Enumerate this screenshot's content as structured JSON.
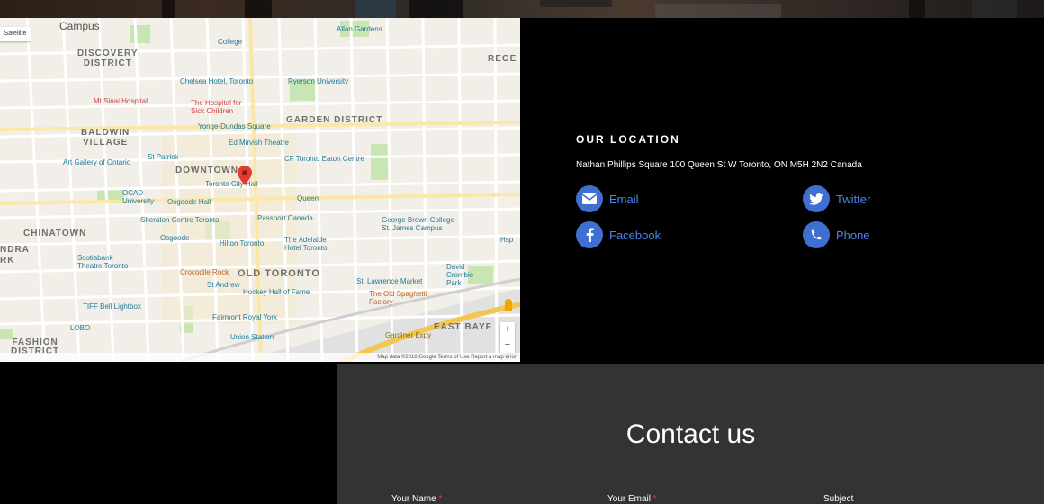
{
  "map": {
    "satellite_label": "Satellite",
    "zoom_in": "+",
    "zoom_out": "−",
    "footer": "Map data ©2018 Google   Terms of Use   Report a map error",
    "labels": {
      "campus": "Campus",
      "discovery_district": "DISCOVERY\nDISTRICT",
      "garden_district": "GARDEN DISTRICT",
      "baldwin_village": "BALDWIN\nVILLAGE",
      "downtown": "DOWNTOWN",
      "chinatown": "CHINATOWN",
      "old_toronto": "OLD TORONTO",
      "fashion_district": "FASHION\nDISTRICT",
      "east_bayfront": "EAST BAYF",
      "regent": "REGE",
      "ndra": "NDRA",
      "rk": "RK"
    },
    "pois": {
      "college": "College",
      "allan_gardens": "Allan Gardens",
      "chelsea_hotel": "Chelsea Hotel, Toronto",
      "ryerson": "Ryerson University",
      "mt_sinai": "Mt Sinai Hospital",
      "sick_children": "The Hospital for Sick Children",
      "yonge_dundas": "Yonge-Dundas Square",
      "ed_mirvish": "Ed Mirvish Theatre",
      "cf_eaton": "CF Toronto Eaton Centre",
      "art_gallery": "Art Gallery of Ontario",
      "st_patrick": "St Patrick",
      "toronto_city_hall": "Toronto City Hall",
      "ocad": "OCAD University",
      "osgoode_hall": "Osgoode Hall",
      "queen": "Queen",
      "sheraton": "Sheraton Centre Toronto",
      "passport_canada": "Passport Canada",
      "george_brown": "George Brown College St. James Campus",
      "osgoode": "Osgoode",
      "hilton": "Hilton Toronto",
      "adelaide": "The Adelaide Hotel Toronto",
      "scotiabank": "Scotiabank Theatre Toronto",
      "crocodile": "Crocodile Rock",
      "st_andrew": "St Andrew",
      "hockey_hall": "Hockey Hall of Fame",
      "st_lawrence": "St. Lawrence Market",
      "david_crombie": "David Crombie Park",
      "tiff": "TIFF Bell Lightbox",
      "fairmont": "Fairmont Royal York",
      "old_spaghetti": "The Old Spaghetti Factory",
      "union": "Union Station",
      "lobo": "LOBO",
      "gardiner": "Gardiner Expy",
      "hsp": "Hsp"
    }
  },
  "location": {
    "title": "OUR LOCATION",
    "address": "Nathan Phillips Square 100 Queen St W Toronto, ON M5H 2N2 Canada",
    "links": [
      {
        "label": "Email",
        "icon": "envelope-icon"
      },
      {
        "label": "Twitter",
        "icon": "twitter-icon"
      },
      {
        "label": "Facebook",
        "icon": "facebook-icon"
      },
      {
        "label": "Phone",
        "icon": "phone-icon"
      }
    ]
  },
  "contact": {
    "title": "Contact us",
    "fields": {
      "name_label": "Your Name",
      "email_label": "Your Email",
      "subject_label": "Subject",
      "required_mark": "*"
    }
  },
  "colors": {
    "accent": "#3f6fd1",
    "link": "#4a86e8",
    "contact_bg": "#333333",
    "page_bg": "#000000"
  }
}
